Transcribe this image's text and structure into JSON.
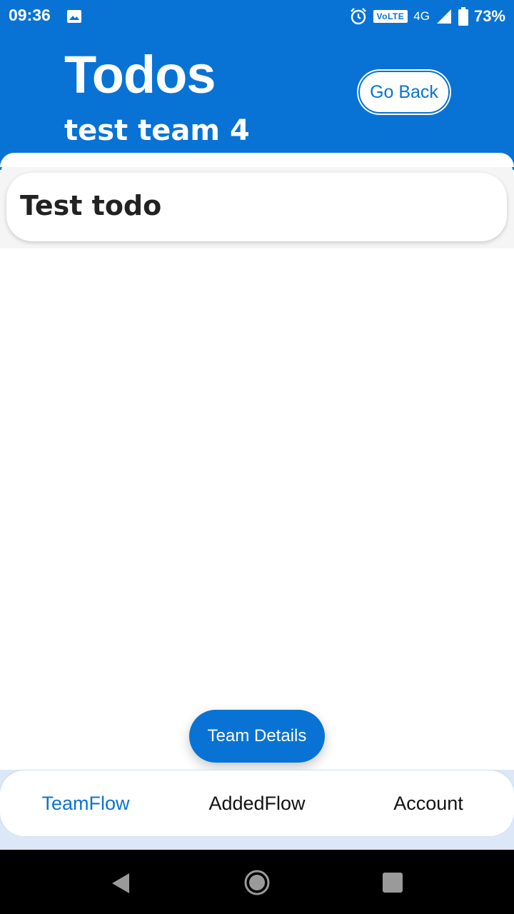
{
  "status_bar": {
    "time": "09:36",
    "volte": "VoLTE",
    "network": "4G",
    "battery": "73%",
    "icons": [
      "gallery-icon",
      "alarm-icon",
      "signal-icon",
      "battery-icon"
    ]
  },
  "header": {
    "title": "Todos",
    "subtitle": "test team 4",
    "go_back_label": "Go Back"
  },
  "todos": [
    {
      "title": "Test todo"
    }
  ],
  "fab": {
    "label": "Team Details"
  },
  "bottom_nav": {
    "items": [
      {
        "label": "TeamFlow",
        "active": true
      },
      {
        "label": "AddedFlow",
        "active": false
      },
      {
        "label": "Account",
        "active": false
      }
    ]
  },
  "colors": {
    "primary": "#0873d4",
    "background": "#ffffff",
    "text_dark": "#222222"
  }
}
